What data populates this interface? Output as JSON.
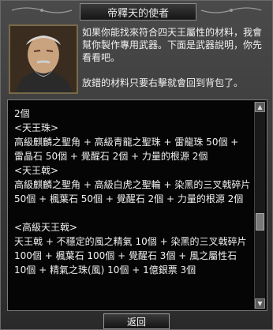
{
  "window": {
    "title": "帝釋天的使者"
  },
  "npc": {
    "portrait_icon": "old-man-portrait-icon",
    "intro": "如果你能找來符合四天王屬性的材料，我會幫你製作專用武器。下面是武器說明，你先看看吧。",
    "note": "放錯的材料只要右擊就會回到背包了。"
  },
  "content": {
    "text": "2個\n<天王珠>\n高級麒麟之聖角 + 高級青龍之聖珠 +  雷龍珠 50個 + 雷晶石 50個 + 覺醒石 2個 + 力量的根源 2個\n<天王戟>\n高級麒麟之聖角 + 高級白虎之聖輪 +  染黑的三叉戟碎片 50個 + 楓葉石 50個 + 覺醒石 2個 + 力量的根源 2個\n\n<高級天王戟>\n天王戟 + 不穩定的風之精氣 10個 +  染黑的三叉戟碎片 100個 + 楓葉石 100個 + 覺醒石 3個 + 風之屬性石 10個 + 精氣之珠(風) 10個 + 1億銀票 3個"
  },
  "scrollbar": {
    "position": 0.6
  },
  "buttons": {
    "back_label": "返回"
  },
  "colors": {
    "frame": "#3a3a3a",
    "text": "#f0f0f0",
    "content_bg": "#050505"
  }
}
